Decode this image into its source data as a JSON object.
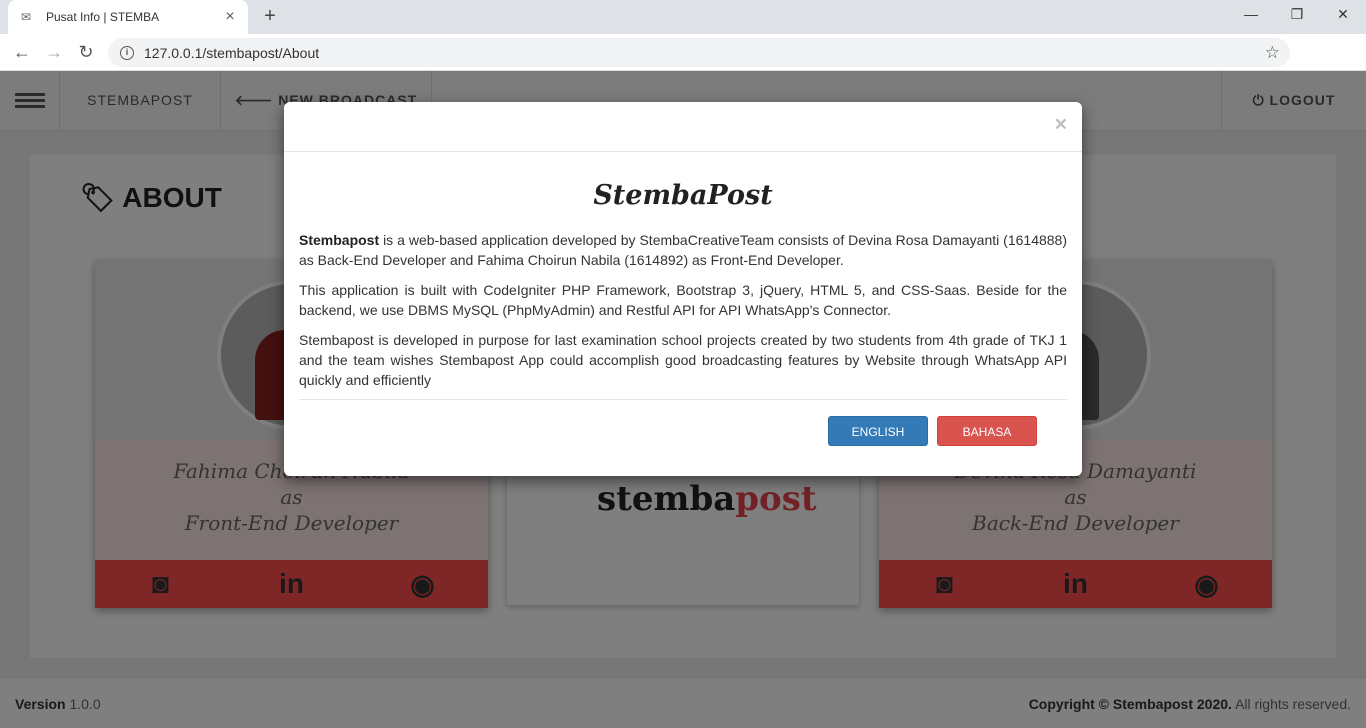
{
  "browser": {
    "tab_title": "Pusat Info | STEMBA",
    "url": "127.0.0.1/stembapost/About"
  },
  "navbar": {
    "brand": "STEMBAPOST",
    "new_broadcast": "NEW BROADCAST",
    "logout": "LOGOUT"
  },
  "page": {
    "heading": "ABOUT",
    "cards": [
      {
        "line1": "Fahima Choirun Nabila",
        "line2": "as",
        "line3": "Front-End Developer"
      },
      {
        "line1": "Devina Rosa Damayanti",
        "line2": "as",
        "line3": "Back-End Developer"
      }
    ],
    "center_logo": {
      "main": "stemba",
      "accent": "post"
    }
  },
  "footer": {
    "version_label": "Version",
    "version_value": "1.0.0",
    "copyright_bold": "Copyright © Stembapost 2020.",
    "copyright_rest": "All rights reserved."
  },
  "modal": {
    "close_symbol": "×",
    "logo": "StembaPost",
    "p1_bold": "Stembapost",
    "p1_rest": " is a web-based application developed by StembaCreativeTeam consists of Devina Rosa Damayanti (1614888) as Back-End Developer and Fahima Choirun Nabila (1614892) as Front-End Developer.",
    "p2": "This application is built with CodeIgniter PHP Framework, Bootstrap 3, jQuery, HTML 5, and CSS-Saas. Beside for the backend, we use DBMS MySQL (PhpMyAdmin) and Restful API for API WhatsApp's Connector.",
    "p3": "Stembapost is developed in purpose for last examination school projects created by two students from 4th grade of TKJ 1 and the team wishes Stembapost App could accomplish good broadcasting features by Website through WhatsApp API quickly and efficiently",
    "btn_english": "ENGLISH",
    "btn_bahasa": "BAHASA"
  }
}
